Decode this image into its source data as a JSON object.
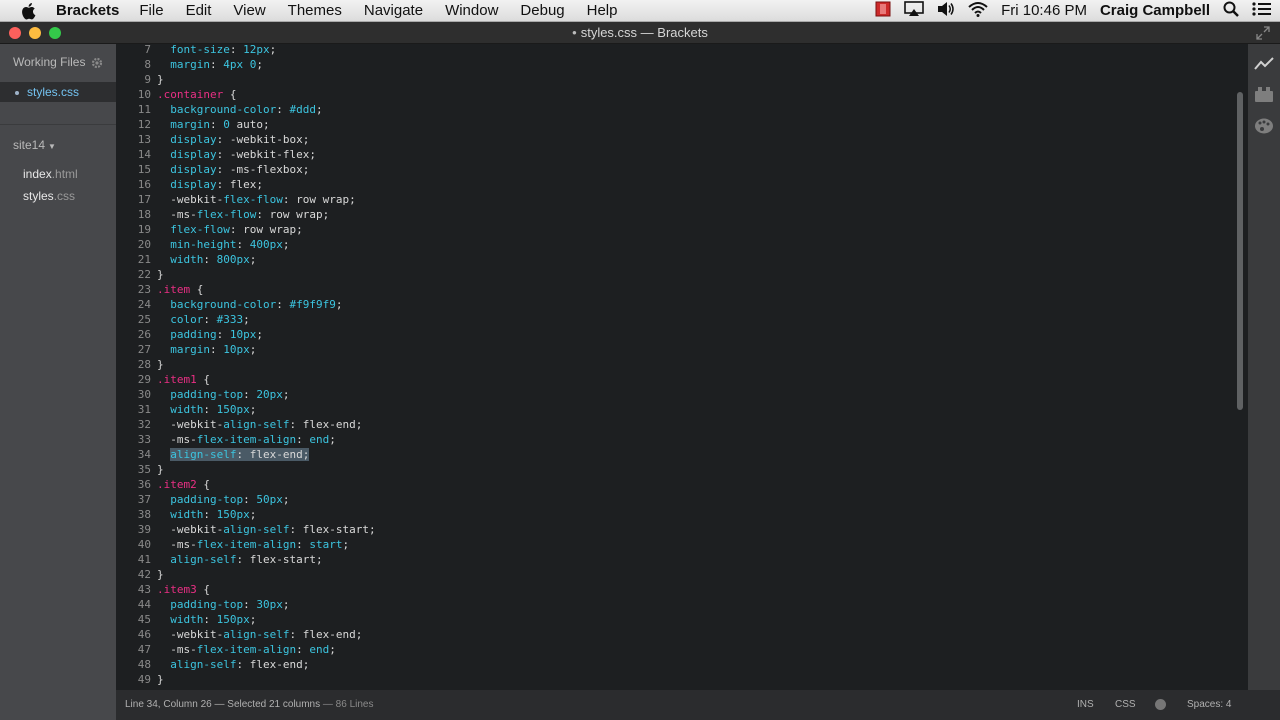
{
  "menubar": {
    "app_name": "Brackets",
    "items": [
      "File",
      "Edit",
      "View",
      "Themes",
      "Navigate",
      "Window",
      "Debug",
      "Help"
    ],
    "clock": "Fri 10:46 PM",
    "user": "Craig Campbell"
  },
  "window": {
    "title": "styles.css — Brackets",
    "dirty_marker": "•"
  },
  "sidebar": {
    "working_files_label": "Working Files",
    "working_file": "styles.css",
    "project_name": "site14",
    "tree": [
      {
        "name": "index",
        "ext": ".html"
      },
      {
        "name": "styles",
        "ext": ".css"
      }
    ]
  },
  "editor": {
    "lines": [
      {
        "n": "7",
        "segs": [
          [
            "plain",
            "  "
          ],
          [
            "prop",
            "font-size"
          ],
          [
            "plain",
            ": "
          ],
          [
            "num",
            "12px"
          ],
          [
            "plain",
            ";"
          ]
        ]
      },
      {
        "n": "8",
        "segs": [
          [
            "plain",
            "  "
          ],
          [
            "prop",
            "margin"
          ],
          [
            "plain",
            ": "
          ],
          [
            "num",
            "4px 0"
          ],
          [
            "plain",
            ";"
          ]
        ]
      },
      {
        "n": "9",
        "segs": [
          [
            "plain",
            "}"
          ]
        ]
      },
      {
        "n": "10",
        "segs": [
          [
            "sel",
            ".container"
          ],
          [
            "plain",
            " {"
          ]
        ]
      },
      {
        "n": "11",
        "segs": [
          [
            "plain",
            "  "
          ],
          [
            "prop",
            "background-color"
          ],
          [
            "plain",
            ": "
          ],
          [
            "hex",
            "#ddd"
          ],
          [
            "plain",
            ";"
          ]
        ]
      },
      {
        "n": "12",
        "segs": [
          [
            "plain",
            "  "
          ],
          [
            "prop",
            "margin"
          ],
          [
            "plain",
            ": "
          ],
          [
            "num",
            "0"
          ],
          [
            "plain",
            " auto;"
          ]
        ]
      },
      {
        "n": "13",
        "segs": [
          [
            "plain",
            "  "
          ],
          [
            "prop",
            "display"
          ],
          [
            "plain",
            ": -webkit-box;"
          ]
        ]
      },
      {
        "n": "14",
        "segs": [
          [
            "plain",
            "  "
          ],
          [
            "prop",
            "display"
          ],
          [
            "plain",
            ": -webkit-flex;"
          ]
        ]
      },
      {
        "n": "15",
        "segs": [
          [
            "plain",
            "  "
          ],
          [
            "prop",
            "display"
          ],
          [
            "plain",
            ": -ms-flexbox;"
          ]
        ]
      },
      {
        "n": "16",
        "segs": [
          [
            "plain",
            "  "
          ],
          [
            "prop",
            "display"
          ],
          [
            "plain",
            ": flex;"
          ]
        ]
      },
      {
        "n": "17",
        "segs": [
          [
            "plain",
            "  "
          ],
          [
            "plain",
            "-webkit-"
          ],
          [
            "prop",
            "flex-flow"
          ],
          [
            "plain",
            ": row wrap;"
          ]
        ]
      },
      {
        "n": "18",
        "segs": [
          [
            "plain",
            "  "
          ],
          [
            "plain",
            "-ms-"
          ],
          [
            "prop",
            "flex-flow"
          ],
          [
            "plain",
            ": row wrap;"
          ]
        ]
      },
      {
        "n": "19",
        "segs": [
          [
            "plain",
            "  "
          ],
          [
            "prop",
            "flex-flow"
          ],
          [
            "plain",
            ": row wrap;"
          ]
        ]
      },
      {
        "n": "20",
        "segs": [
          [
            "plain",
            "  "
          ],
          [
            "prop",
            "min-height"
          ],
          [
            "plain",
            ": "
          ],
          [
            "num",
            "400px"
          ],
          [
            "plain",
            ";"
          ]
        ]
      },
      {
        "n": "21",
        "segs": [
          [
            "plain",
            "  "
          ],
          [
            "prop",
            "width"
          ],
          [
            "plain",
            ": "
          ],
          [
            "num",
            "800px"
          ],
          [
            "plain",
            ";"
          ]
        ]
      },
      {
        "n": "22",
        "segs": [
          [
            "plain",
            "}"
          ]
        ]
      },
      {
        "n": "23",
        "segs": [
          [
            "sel",
            ".item"
          ],
          [
            "plain",
            " {"
          ]
        ]
      },
      {
        "n": "24",
        "segs": [
          [
            "plain",
            "  "
          ],
          [
            "prop",
            "background-color"
          ],
          [
            "plain",
            ": "
          ],
          [
            "hex",
            "#f9f9f9"
          ],
          [
            "plain",
            ";"
          ]
        ]
      },
      {
        "n": "25",
        "segs": [
          [
            "plain",
            "  "
          ],
          [
            "prop",
            "color"
          ],
          [
            "plain",
            ": "
          ],
          [
            "hex",
            "#333"
          ],
          [
            "plain",
            ";"
          ]
        ]
      },
      {
        "n": "26",
        "segs": [
          [
            "plain",
            "  "
          ],
          [
            "prop",
            "padding"
          ],
          [
            "plain",
            ": "
          ],
          [
            "num",
            "10px"
          ],
          [
            "plain",
            ";"
          ]
        ]
      },
      {
        "n": "27",
        "segs": [
          [
            "plain",
            "  "
          ],
          [
            "prop",
            "margin"
          ],
          [
            "plain",
            ": "
          ],
          [
            "num",
            "10px"
          ],
          [
            "plain",
            ";"
          ]
        ]
      },
      {
        "n": "28",
        "segs": [
          [
            "plain",
            "}"
          ]
        ]
      },
      {
        "n": "29",
        "segs": [
          [
            "sel",
            ".item1"
          ],
          [
            "plain",
            " {"
          ]
        ]
      },
      {
        "n": "30",
        "segs": [
          [
            "plain",
            "  "
          ],
          [
            "prop",
            "padding-top"
          ],
          [
            "plain",
            ": "
          ],
          [
            "num",
            "20px"
          ],
          [
            "plain",
            ";"
          ]
        ]
      },
      {
        "n": "31",
        "segs": [
          [
            "plain",
            "  "
          ],
          [
            "prop",
            "width"
          ],
          [
            "plain",
            ": "
          ],
          [
            "num",
            "150px"
          ],
          [
            "plain",
            ";"
          ]
        ]
      },
      {
        "n": "32",
        "segs": [
          [
            "plain",
            "  "
          ],
          [
            "plain",
            "-webkit-"
          ],
          [
            "prop",
            "align-self"
          ],
          [
            "plain",
            ": flex-end;"
          ]
        ]
      },
      {
        "n": "33",
        "segs": [
          [
            "plain",
            "  "
          ],
          [
            "plain",
            "-ms-"
          ],
          [
            "prop",
            "flex-item-align"
          ],
          [
            "plain",
            ": "
          ],
          [
            "kw",
            "end"
          ],
          [
            "plain",
            ";"
          ]
        ]
      },
      {
        "n": "34",
        "segs": [
          [
            "plain",
            "  "
          ],
          [
            "prop hl",
            "align-self"
          ],
          [
            "plain hl",
            ": flex-end;"
          ]
        ]
      },
      {
        "n": "35",
        "segs": [
          [
            "plain",
            "}"
          ]
        ]
      },
      {
        "n": "36",
        "segs": [
          [
            "sel",
            ".item2"
          ],
          [
            "plain",
            " {"
          ]
        ]
      },
      {
        "n": "37",
        "segs": [
          [
            "plain",
            "  "
          ],
          [
            "prop",
            "padding-top"
          ],
          [
            "plain",
            ": "
          ],
          [
            "num",
            "50px"
          ],
          [
            "plain",
            ";"
          ]
        ]
      },
      {
        "n": "38",
        "segs": [
          [
            "plain",
            "  "
          ],
          [
            "prop",
            "width"
          ],
          [
            "plain",
            ": "
          ],
          [
            "num",
            "150px"
          ],
          [
            "plain",
            ";"
          ]
        ]
      },
      {
        "n": "39",
        "segs": [
          [
            "plain",
            "  "
          ],
          [
            "plain",
            "-webkit-"
          ],
          [
            "prop",
            "align-self"
          ],
          [
            "plain",
            ": flex-start;"
          ]
        ]
      },
      {
        "n": "40",
        "segs": [
          [
            "plain",
            "  "
          ],
          [
            "plain",
            "-ms-"
          ],
          [
            "prop",
            "flex-item-align"
          ],
          [
            "plain",
            ": "
          ],
          [
            "kw",
            "start"
          ],
          [
            "plain",
            ";"
          ]
        ]
      },
      {
        "n": "41",
        "segs": [
          [
            "plain",
            "  "
          ],
          [
            "prop",
            "align-self"
          ],
          [
            "plain",
            ": flex-start;"
          ]
        ]
      },
      {
        "n": "42",
        "segs": [
          [
            "plain",
            "}"
          ]
        ]
      },
      {
        "n": "43",
        "segs": [
          [
            "sel",
            ".item3"
          ],
          [
            "plain",
            " {"
          ]
        ]
      },
      {
        "n": "44",
        "segs": [
          [
            "plain",
            "  "
          ],
          [
            "prop",
            "padding-top"
          ],
          [
            "plain",
            ": "
          ],
          [
            "num",
            "30px"
          ],
          [
            "plain",
            ";"
          ]
        ]
      },
      {
        "n": "45",
        "segs": [
          [
            "plain",
            "  "
          ],
          [
            "prop",
            "width"
          ],
          [
            "plain",
            ": "
          ],
          [
            "num",
            "150px"
          ],
          [
            "plain",
            ";"
          ]
        ]
      },
      {
        "n": "46",
        "segs": [
          [
            "plain",
            "  "
          ],
          [
            "plain",
            "-webkit-"
          ],
          [
            "prop",
            "align-self"
          ],
          [
            "plain",
            ": flex-end;"
          ]
        ]
      },
      {
        "n": "47",
        "segs": [
          [
            "plain",
            "  "
          ],
          [
            "plain",
            "-ms-"
          ],
          [
            "prop",
            "flex-item-align"
          ],
          [
            "plain",
            ": "
          ],
          [
            "kw",
            "end"
          ],
          [
            "plain",
            ";"
          ]
        ]
      },
      {
        "n": "48",
        "segs": [
          [
            "plain",
            "  "
          ],
          [
            "prop",
            "align-self"
          ],
          [
            "plain",
            ": flex-end;"
          ]
        ]
      },
      {
        "n": "49",
        "segs": [
          [
            "plain",
            "}"
          ]
        ]
      }
    ]
  },
  "statusbar": {
    "cursor": "Line 34, Column 26 — Selected 21 columns",
    "lines": "— 86 Lines",
    "mode": "INS",
    "language": "CSS",
    "spaces": "Spaces: 4"
  },
  "colors": {
    "selector": "#ea2f84",
    "property": "#3cc5e0",
    "accent": "#74c3f1"
  },
  "icons": [
    "apple-icon",
    "gear-icon",
    "live-preview-icon",
    "extension-manager-icon",
    "theme-icon",
    "wifi-icon",
    "volume-icon",
    "airplay-icon",
    "search-icon",
    "menu-list-icon"
  ]
}
